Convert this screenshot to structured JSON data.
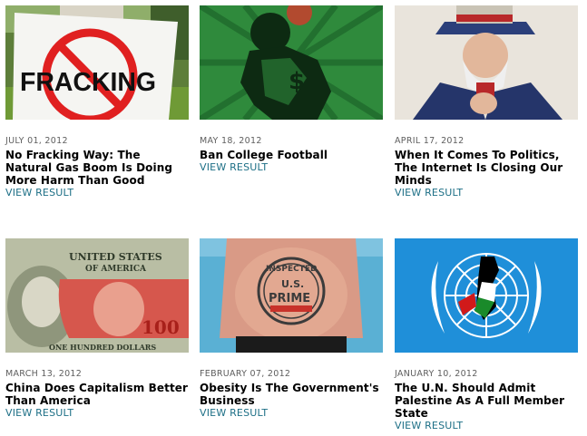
{
  "articles": [
    {
      "date": "JULY 01, 2012",
      "title": "No Fracking Way: The Natural Gas Boom Is Doing More Harm Than Good",
      "link": "VIEW RESULT",
      "sign_text": "FRACKING"
    },
    {
      "date": "MAY 18, 2012",
      "title": "Ban College Football",
      "link": "VIEW RESULT"
    },
    {
      "date": "APRIL 17, 2012",
      "title": "When It Comes To Politics, The Internet Is Closing Our Minds",
      "link": "VIEW RESULT"
    },
    {
      "date": "MARCH 13, 2012",
      "title": "China Does Capitalism Better Than America",
      "link": "VIEW RESULT",
      "bill_top": "UNITED STATES",
      "bill_sub": "OF AMERICA",
      "bill_100": "100",
      "bill_bottom": "ONE HUNDRED DOLLARS"
    },
    {
      "date": "FEBRUARY 07, 2012",
      "title": "Obesity Is The Government's Business",
      "link": "VIEW RESULT",
      "stamp_line1": "INSPECTED",
      "stamp_line2": "U.S.",
      "stamp_line3": "PRIME"
    },
    {
      "date": "JANUARY 10, 2012",
      "title": "The U.N. Should Admit Palestine As A Full Member State",
      "link": "VIEW RESULT"
    }
  ]
}
